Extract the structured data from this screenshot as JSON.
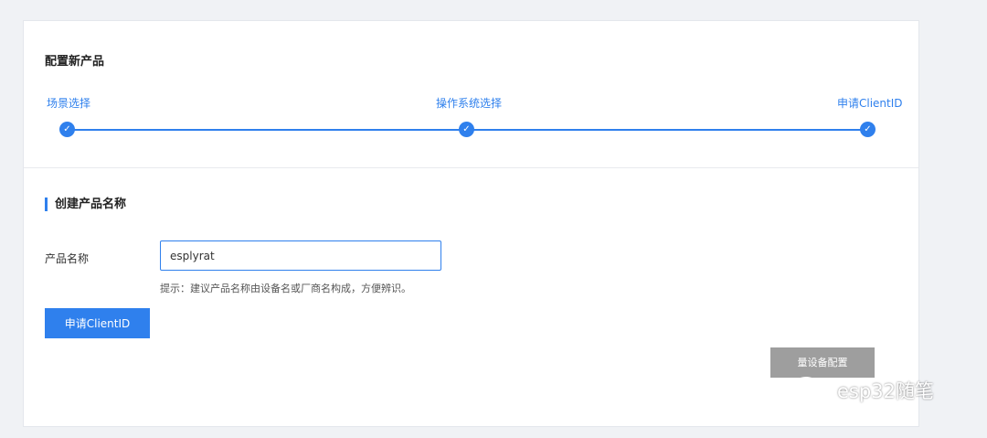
{
  "page": {
    "title": "配置新产品"
  },
  "steps": [
    {
      "label": "场景选择",
      "icon": "check-icon",
      "status": "done"
    },
    {
      "label": "操作系统选择",
      "icon": "check-icon",
      "status": "done"
    },
    {
      "label": "申请ClientID",
      "icon": "check-icon",
      "status": "done"
    }
  ],
  "form": {
    "section_title": "创建产品名称",
    "name_label": "产品名称",
    "name_value": "esplyrat",
    "hint": "提示：建议产品名称由设备名或厂商名构成，方便辨识。",
    "submit_label": "申请ClientID"
  },
  "floating": {
    "label": "量设备配置"
  },
  "watermark": {
    "text": "esp32随笔",
    "icon": "wechat-icon"
  },
  "colors": {
    "accent": "#2f80ed",
    "background": "#f0f2f5",
    "card": "#ffffff"
  }
}
